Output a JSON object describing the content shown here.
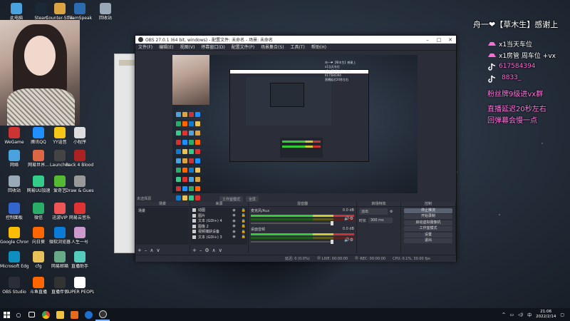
{
  "desktop_icons": [
    {
      "label": "此电脑",
      "color": "#4aa3df"
    },
    {
      "label": "Steam",
      "color": "#1b2838"
    },
    {
      "label": "Counter-Strike",
      "color": "#d9a441"
    },
    {
      "label": "TeamSpeak",
      "color": "#2b6cb0"
    },
    {
      "label": "回收站",
      "color": "#9aa9b8"
    },
    {
      "label": "WeGame",
      "color": "#c33"
    },
    {
      "label": "腾讯QQ",
      "color": "#1e90ff"
    },
    {
      "label": "YY语音",
      "color": "#f5c518"
    },
    {
      "label": "小程序",
      "color": "#ddd"
    },
    {
      "label": "网络",
      "color": "#4aa3df"
    },
    {
      "label": "网易世界...",
      "color": "#d64"
    },
    {
      "label": "Launcher",
      "color": "#444"
    },
    {
      "label": "Back 4 Blood Beta",
      "color": "#a22"
    },
    {
      "label": "回收站",
      "color": "#9aa9b8"
    },
    {
      "label": "网易UU加速",
      "color": "#3c8"
    },
    {
      "label": "爱奇艺",
      "color": "#5b3"
    },
    {
      "label": "Draw & Guess",
      "color": "#999"
    },
    {
      "label": "控制面板",
      "color": "#36c"
    },
    {
      "label": "微信",
      "color": "#2aae67"
    },
    {
      "label": "迅游VIP",
      "color": "#e55"
    },
    {
      "label": "网易云音乐",
      "color": "#d33"
    },
    {
      "label": "Google Chrome",
      "color": "#fbbc05"
    },
    {
      "label": "向日葵",
      "color": "#f60"
    },
    {
      "label": "微软浏览器",
      "color": "#0a7cd6"
    },
    {
      "label": "人生一号",
      "color": "#c9c"
    },
    {
      "label": "Microsoft Edge",
      "color": "#0f8fc0"
    },
    {
      "label": "cfg",
      "color": "#e8c15a"
    },
    {
      "label": "网易邮箱",
      "color": "#6a8"
    },
    {
      "label": "直播助手",
      "color": "#5cb"
    },
    {
      "label": "OBS Studio",
      "color": "#2b2e38"
    },
    {
      "label": "斗鱼直播",
      "color": "#f60"
    },
    {
      "label": "直播伴侣",
      "color": "#333"
    },
    {
      "label": "SUPER PEOPLE CBT",
      "color": "#fff"
    }
  ],
  "obs": {
    "title": "OBS 27.0.1 (64 bit, windows) - 配置文件: 未命名 - 场景: 未命名",
    "menu": [
      "文件(F)",
      "编辑(E)",
      "视图(V)",
      "停靠窗口(D)",
      "配置文件(P)",
      "场景集合(S)",
      "工具(T)",
      "帮助(H)"
    ],
    "transport": [
      "工作室模式",
      "全屏"
    ],
    "docks": {
      "scenes_title": "场景",
      "sources_title": "来源",
      "mixer_title": "混音器",
      "transitions_title": "转场特效",
      "controls_title": "控制"
    },
    "scenes": [
      "场景"
    ],
    "sources": [
      "动图",
      "图片",
      "文本 (GDI+) 4",
      "图像 2",
      "视频捕获设备",
      "文本 (GDI+) 3"
    ],
    "mixer": [
      {
        "name": "麦克风/Aux",
        "db": "0.0 dB"
      },
      {
        "name": "桌面音频",
        "db": "0.0 dB"
      }
    ],
    "transition": {
      "type": "淡出",
      "duration_label": "时长",
      "duration": "300 ms"
    },
    "controls": [
      "停止推流",
      "开始录制",
      "启动虚拟摄像机",
      "工作室模式",
      "设置",
      "退出"
    ],
    "status": {
      "live": "LIVE: 00:00:00",
      "rec": "REC: 00:00:00",
      "cpu": "CPU: 0.1%, 30.00 fps",
      "dropped": "延迟: 0 (0.0%)"
    },
    "source_toggle_label": "未选择源"
  },
  "overlay": {
    "title": "舟一❤【草木生】感谢上",
    "line1": "x1当天车位",
    "line2": "x1房管 周车位 +vx",
    "line3": "617584394",
    "line4": "8833_",
    "line5": "粉丝牌9级进vx群",
    "big1": "直播延迟20秒左右",
    "big2": "回弹幕会慢一点"
  },
  "taskbar": {
    "time": "21:06",
    "date": "2022/2/14",
    "lang": "中"
  },
  "colors": {
    "obs_bg": "#2b2e38",
    "overlay_pink": "#ff7ae0",
    "taskbar": "#10151c"
  }
}
